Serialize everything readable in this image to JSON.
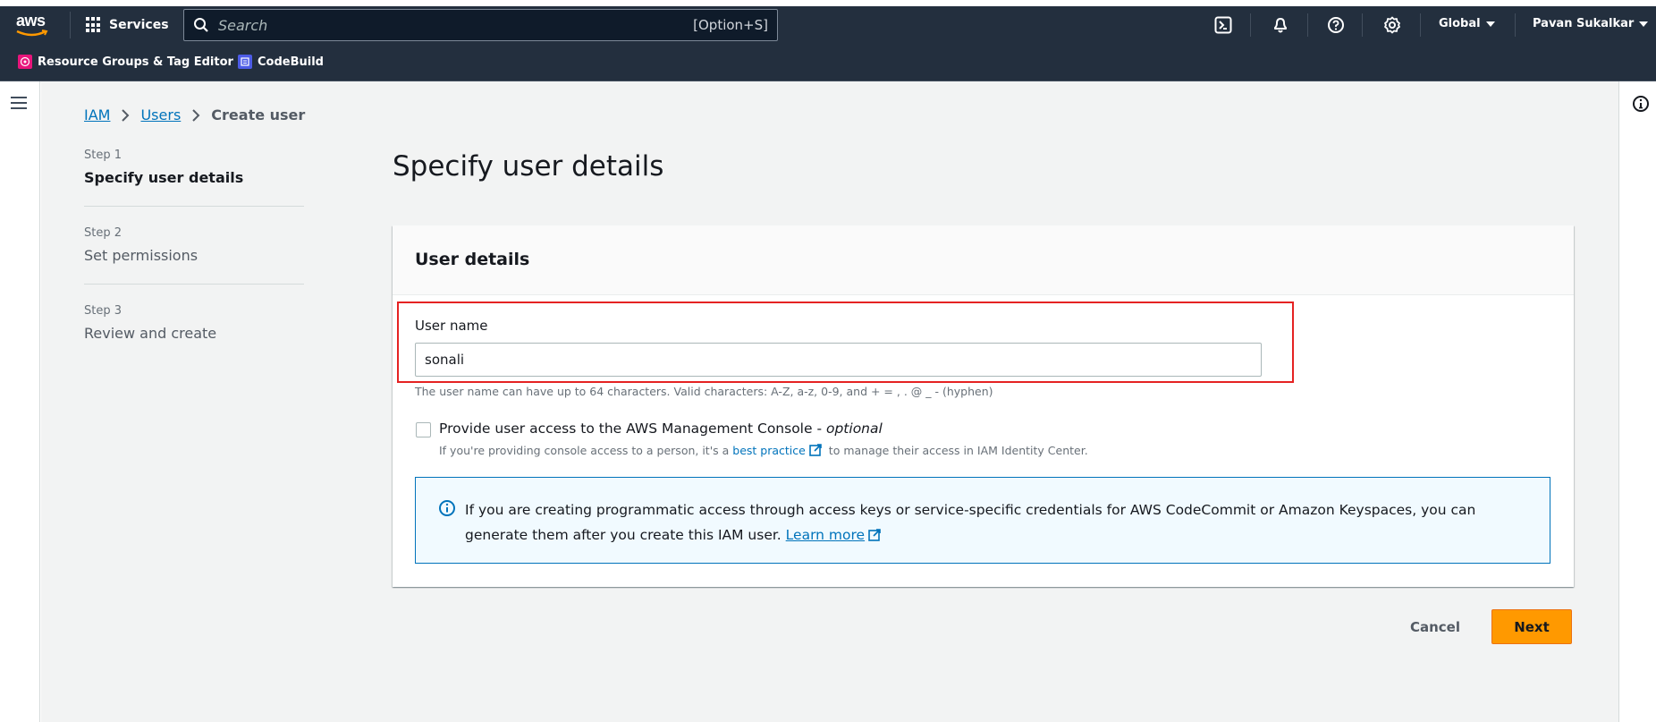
{
  "topbar": {
    "logo_text": "aws",
    "services_label": "Services",
    "search": {
      "placeholder": "Search",
      "value": "",
      "shortcut": "[Option+S]"
    },
    "icons": [
      "cloudshell-icon",
      "bell-icon",
      "help-icon",
      "gear-icon"
    ],
    "region_label": "Global",
    "user_label": "Pavan Sukalkar",
    "favorites": [
      {
        "label": "Resource Groups & Tag Editor",
        "icon": "resource-groups-icon",
        "color": "#e7157b"
      },
      {
        "label": "CodeBuild",
        "icon": "codebuild-icon",
        "color": "#4d5ce6"
      }
    ]
  },
  "breadcrumb": [
    {
      "label": "IAM",
      "link": true
    },
    {
      "label": "Users",
      "link": true
    },
    {
      "label": "Create user",
      "link": false
    }
  ],
  "wizard": {
    "steps": [
      {
        "number": "Step 1",
        "title": "Specify user details",
        "active": true
      },
      {
        "number": "Step 2",
        "title": "Set permissions",
        "active": false
      },
      {
        "number": "Step 3",
        "title": "Review and create",
        "active": false
      }
    ]
  },
  "page": {
    "title": "Specify user details",
    "card_title": "User details",
    "username": {
      "label": "User name",
      "value": "sonali",
      "constraint": "The user name can have up to 64 characters. Valid characters: A-Z, a-z, 0-9, and + = , . @ _ - (hyphen)"
    },
    "console_access": {
      "label": "Provide user access to the AWS Management Console - ",
      "label_optional": "optional",
      "checked": false,
      "desc_before": "If you're providing console access to a person, it's a ",
      "desc_link": "best practice",
      "desc_after": " to manage their access in IAM Identity Center."
    },
    "alert": {
      "text": "If you are creating programmatic access through access keys or service-specific credentials for AWS CodeCommit or Amazon Keyspaces, you can generate them after you create this IAM user. ",
      "link": "Learn more"
    }
  },
  "actions": {
    "cancel_label": "Cancel",
    "next_label": "Next"
  },
  "colors": {
    "header_bg": "#232f3e",
    "primary_button": "#ff9900",
    "link": "#0073bb",
    "highlight": "#e52222"
  }
}
